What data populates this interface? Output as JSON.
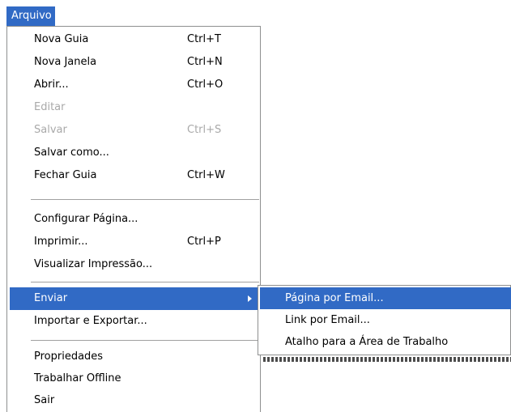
{
  "menubar": {
    "title": "Arquivo"
  },
  "menu": {
    "items": [
      {
        "label": "Nova Guia",
        "shortcut": "Ctrl+T"
      },
      {
        "label": "Nova Janela",
        "shortcut": "Ctrl+N"
      },
      {
        "label": "Abrir...",
        "shortcut": "Ctrl+O"
      },
      {
        "label": "Editar",
        "shortcut": ""
      },
      {
        "label": "Salvar",
        "shortcut": "Ctrl+S"
      },
      {
        "label": "Salvar como...",
        "shortcut": ""
      },
      {
        "label": "Fechar Guia",
        "shortcut": "Ctrl+W"
      },
      {
        "label": "Configurar Página...",
        "shortcut": ""
      },
      {
        "label": "Imprimir...",
        "shortcut": "Ctrl+P"
      },
      {
        "label": "Visualizar Impressão...",
        "shortcut": ""
      },
      {
        "label": "Enviar",
        "shortcut": ""
      },
      {
        "label": "Importar e Exportar...",
        "shortcut": ""
      },
      {
        "label": "Propriedades",
        "shortcut": ""
      },
      {
        "label": "Trabalhar Offline",
        "shortcut": ""
      },
      {
        "label": "Sair",
        "shortcut": ""
      }
    ]
  },
  "submenu": {
    "items": [
      {
        "label": "Página por Email..."
      },
      {
        "label": "Link por Email..."
      },
      {
        "label": "Atalho para a Área de Trabalho"
      }
    ]
  },
  "colors": {
    "highlight": "#316ac5",
    "disabled": "#a9a9a9",
    "border": "#8e8f8f"
  }
}
